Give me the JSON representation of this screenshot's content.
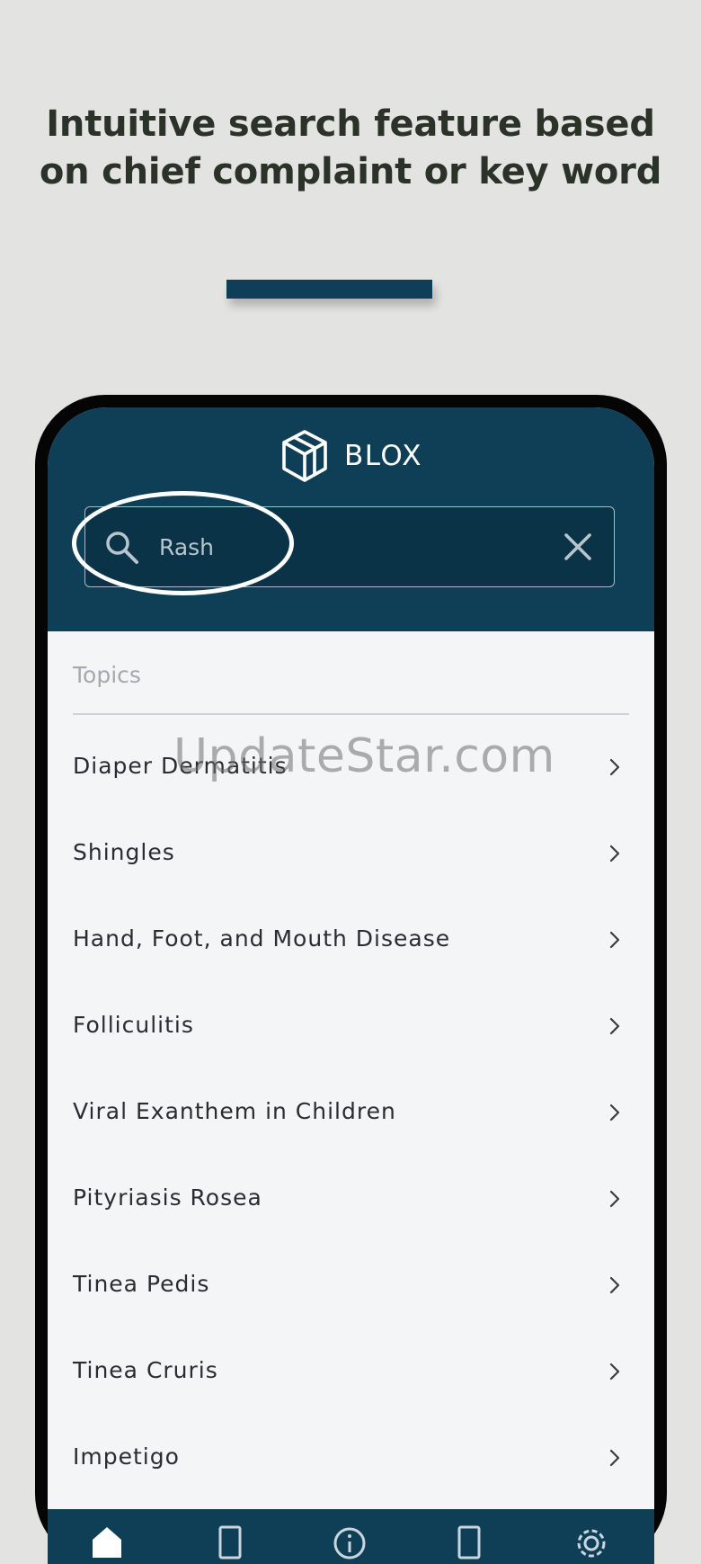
{
  "promo": {
    "headline": "Intuitive search feature based on chief complaint or key word"
  },
  "app": {
    "brand_name": "BLOX",
    "search": {
      "value": "Rash",
      "icon": "search-icon",
      "clear_icon": "close-icon"
    },
    "section_label": "Topics",
    "topics": [
      "Diaper Dermatitis",
      "Shingles",
      "Hand, Foot, and Mouth Disease",
      "Folliculitis",
      "Viral Exanthem in Children",
      "Pityriasis Rosea",
      "Tinea Pedis",
      "Tinea Cruris",
      "Impetigo"
    ],
    "bottom_nav": [
      {
        "icon": "home-icon"
      },
      {
        "icon": "bookmark-icon"
      },
      {
        "icon": "info-icon"
      },
      {
        "icon": "notes-icon"
      },
      {
        "icon": "gear-icon"
      }
    ]
  },
  "watermark": "UpdateStar.com",
  "colors": {
    "page_background": "#e3e3e2",
    "headline_text": "#2b3329",
    "brand_navy": "#0f3f57",
    "list_background": "#f4f5f7",
    "list_text": "#2a2d30",
    "muted_text": "#a5a9ad"
  }
}
